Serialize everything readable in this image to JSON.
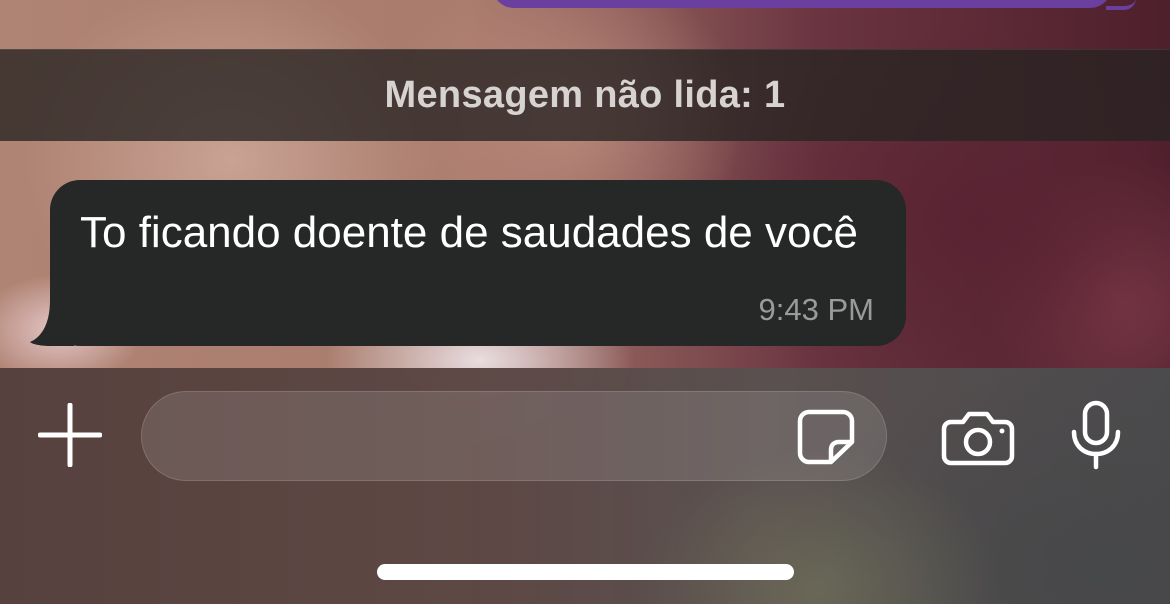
{
  "chat": {
    "unread_banner": "Mensagem não lida: 1",
    "incoming_message": {
      "text": "To ficando doente de saudades de você",
      "time": "9:43 PM"
    },
    "outgoing_bubble_color": "#6a3fa0",
    "incoming_bubble_color": "#262727"
  },
  "composer": {
    "message_value": "",
    "icons": {
      "attach": "plus-icon",
      "sticker": "sticker-icon",
      "camera": "camera-icon",
      "microphone": "microphone-icon"
    }
  },
  "system": {
    "home_indicator": "home-indicator"
  }
}
